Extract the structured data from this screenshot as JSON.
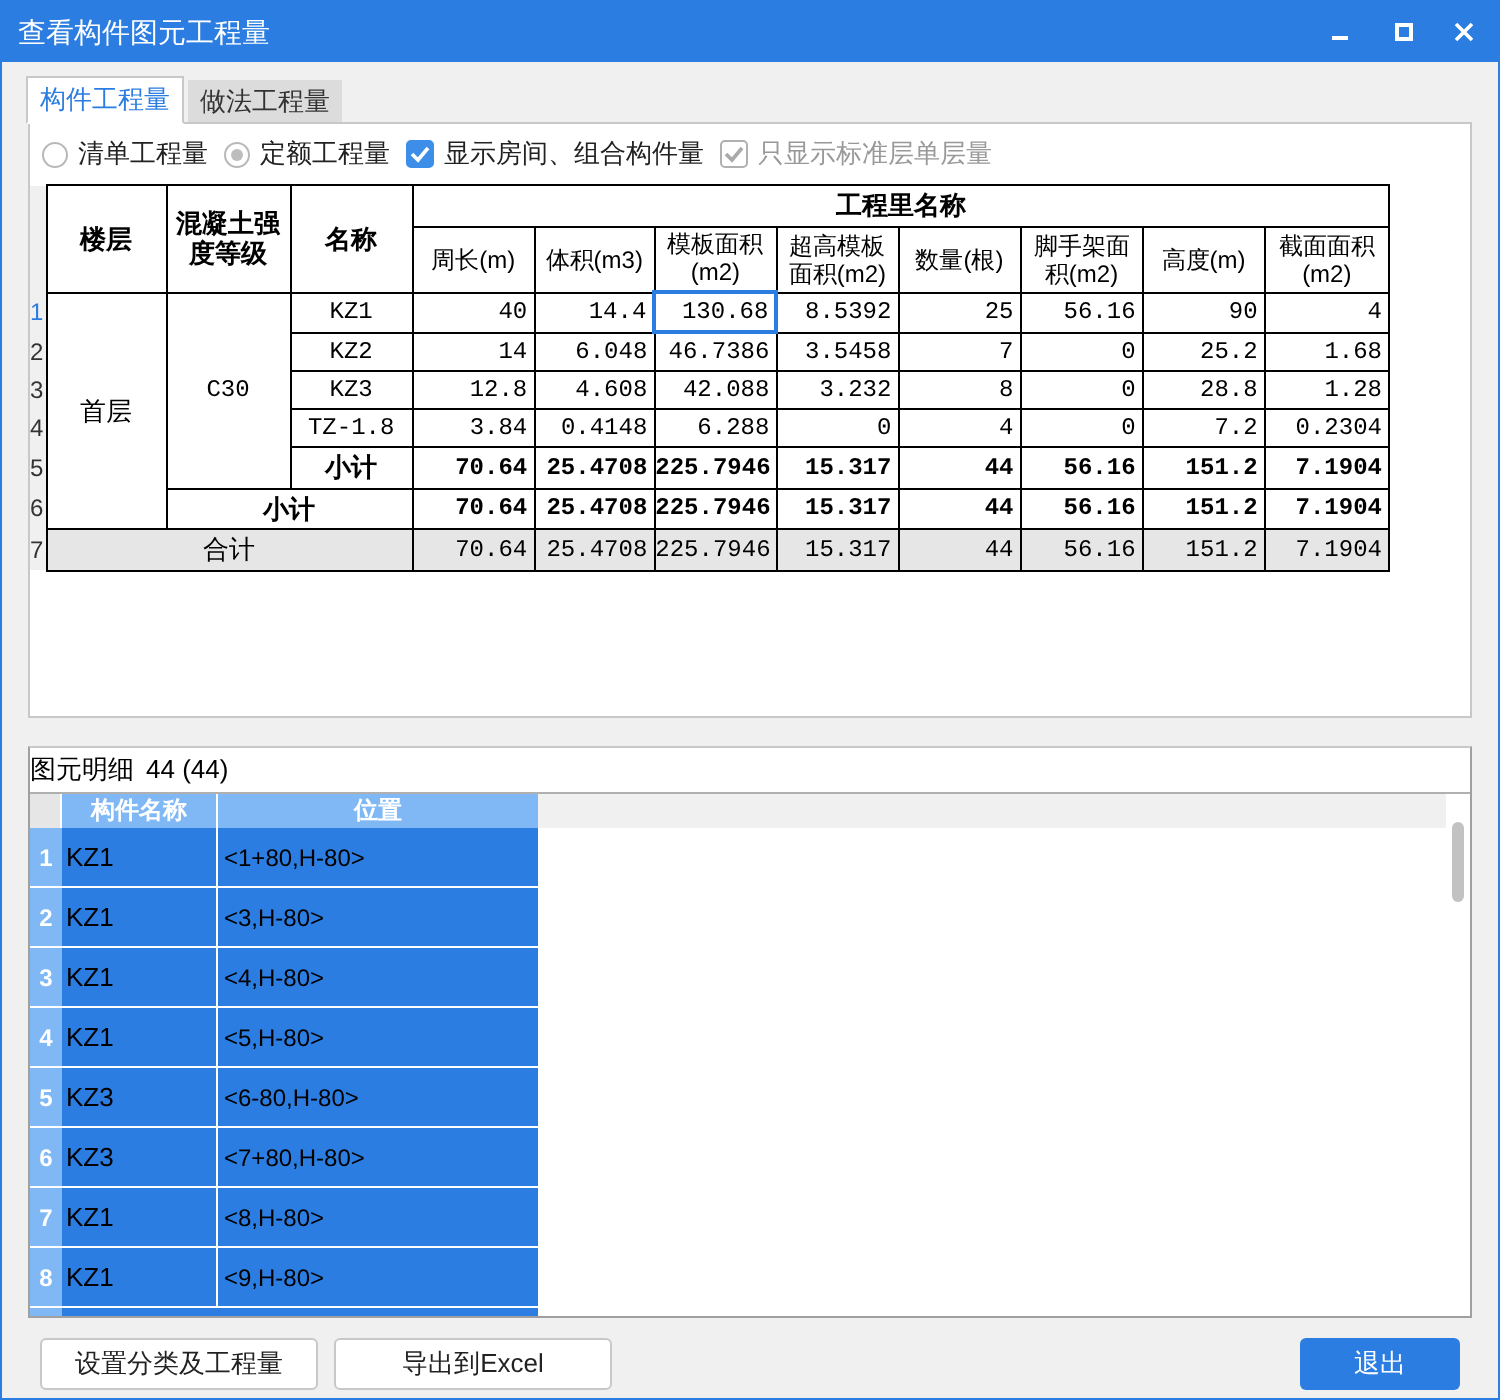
{
  "window": {
    "title": "查看构件图元工程量"
  },
  "tabs": [
    {
      "label": "构件工程量",
      "selected": true
    },
    {
      "label": "做法工程量",
      "selected": false
    }
  ],
  "options": [
    {
      "kind": "radio",
      "label": "清单工程量",
      "checked": false,
      "disabled": false
    },
    {
      "kind": "radio",
      "label": "定额工程量",
      "checked": true,
      "disabled": false
    },
    {
      "kind": "checkbox",
      "label": "显示房间、组合构件量",
      "checked": true,
      "disabled": false
    },
    {
      "kind": "checkbox",
      "label": "只显示标准层单层量",
      "checked": true,
      "disabled": true
    }
  ],
  "quantity_table": {
    "floor_header": "楼层",
    "grade_header": "混凝土强度等级",
    "name_header": "名称",
    "group_header": "工程里名称",
    "columns": [
      "周长(m)",
      "体积(m3)",
      "模板面积(m2)",
      "超高模板面积(m2)",
      "数量(根)",
      "脚手架面积(m2)",
      "高度(m)",
      "截面面积(m2)"
    ],
    "floor": "首层",
    "grade": "C30",
    "rows": [
      {
        "number": "1",
        "kind": "item",
        "name": "KZ1",
        "cells": [
          {
            "text": "40",
            "focused": false
          },
          {
            "text": "14.4",
            "focused": false
          },
          {
            "text": "130.68",
            "focused": true
          },
          {
            "text": "8.5392",
            "focused": false
          },
          {
            "text": "25",
            "focused": false
          },
          {
            "text": "56.16",
            "focused": false
          },
          {
            "text": "90",
            "focused": false
          },
          {
            "text": "4",
            "focused": false
          }
        ]
      },
      {
        "number": "2",
        "kind": "item",
        "name": "KZ2",
        "cells": [
          {
            "text": "14",
            "focused": false
          },
          {
            "text": "6.048",
            "focused": false
          },
          {
            "text": "46.7386",
            "focused": false
          },
          {
            "text": "3.5458",
            "focused": false
          },
          {
            "text": "7",
            "focused": false
          },
          {
            "text": "0",
            "focused": false
          },
          {
            "text": "25.2",
            "focused": false
          },
          {
            "text": "1.68",
            "focused": false
          }
        ]
      },
      {
        "number": "3",
        "kind": "item",
        "name": "KZ3",
        "cells": [
          {
            "text": "12.8",
            "focused": false
          },
          {
            "text": "4.608",
            "focused": false
          },
          {
            "text": "42.088",
            "focused": false
          },
          {
            "text": "3.232",
            "focused": false
          },
          {
            "text": "8",
            "focused": false
          },
          {
            "text": "0",
            "focused": false
          },
          {
            "text": "28.8",
            "focused": false
          },
          {
            "text": "1.28",
            "focused": false
          }
        ]
      },
      {
        "number": "4",
        "kind": "item",
        "name": "TZ-1.8",
        "cells": [
          {
            "text": "3.84",
            "focused": false
          },
          {
            "text": "0.4148",
            "focused": false
          },
          {
            "text": "6.288",
            "focused": false
          },
          {
            "text": "0",
            "focused": false
          },
          {
            "text": "4",
            "focused": false
          },
          {
            "text": "0",
            "focused": false
          },
          {
            "text": "7.2",
            "focused": false
          },
          {
            "text": "0.2304",
            "focused": false
          }
        ]
      },
      {
        "number": "5",
        "kind": "grade_subtotal",
        "name": "小计",
        "cells": [
          {
            "text": "70.64",
            "focused": false
          },
          {
            "text": "25.4708",
            "focused": false
          },
          {
            "text": "225.7946",
            "focused": false
          },
          {
            "text": "15.317",
            "focused": false
          },
          {
            "text": "44",
            "focused": false
          },
          {
            "text": "56.16",
            "focused": false
          },
          {
            "text": "151.2",
            "focused": false
          },
          {
            "text": "7.1904",
            "focused": false
          }
        ]
      },
      {
        "number": "6",
        "kind": "floor_subtotal",
        "name": "小计",
        "cells": [
          {
            "text": "70.64",
            "focused": false
          },
          {
            "text": "25.4708",
            "focused": false
          },
          {
            "text": "225.7946",
            "focused": false
          },
          {
            "text": "15.317",
            "focused": false
          },
          {
            "text": "44",
            "focused": false
          },
          {
            "text": "56.16",
            "focused": false
          },
          {
            "text": "151.2",
            "focused": false
          },
          {
            "text": "7.1904",
            "focused": false
          }
        ]
      },
      {
        "number": "7",
        "kind": "total",
        "name": "合计",
        "cells": [
          {
            "text": "70.64",
            "focused": false
          },
          {
            "text": "25.4708",
            "focused": false
          },
          {
            "text": "225.7946",
            "focused": false
          },
          {
            "text": "15.317",
            "focused": false
          },
          {
            "text": "44",
            "focused": false
          },
          {
            "text": "56.16",
            "focused": false
          },
          {
            "text": "151.2",
            "focused": false
          },
          {
            "text": "7.1904",
            "focused": false
          }
        ]
      }
    ]
  },
  "detail": {
    "label": "图元明细",
    "count": "44 (44)",
    "columns": [
      "构件名称",
      "位置"
    ],
    "rows": [
      {
        "number": "1",
        "name": "KZ1",
        "position": "<1+80,H-80>",
        "selected": true
      },
      {
        "number": "2",
        "name": "KZ1",
        "position": "<3,H-80>",
        "selected": true
      },
      {
        "number": "3",
        "name": "KZ1",
        "position": "<4,H-80>",
        "selected": true
      },
      {
        "number": "4",
        "name": "KZ1",
        "position": "<5,H-80>",
        "selected": true
      },
      {
        "number": "5",
        "name": "KZ3",
        "position": "<6-80,H-80>",
        "selected": true
      },
      {
        "number": "6",
        "name": "KZ3",
        "position": "<7+80,H-80>",
        "selected": true
      },
      {
        "number": "7",
        "name": "KZ1",
        "position": "<8,H-80>",
        "selected": true
      },
      {
        "number": "8",
        "name": "KZ1",
        "position": "<9,H-80>",
        "selected": true
      }
    ]
  },
  "buttons": [
    {
      "label": "设置分类及工程量",
      "kind": "normal"
    },
    {
      "label": "导出到Excel",
      "kind": "normal"
    },
    {
      "label": "退出",
      "kind": "primary"
    }
  ]
}
